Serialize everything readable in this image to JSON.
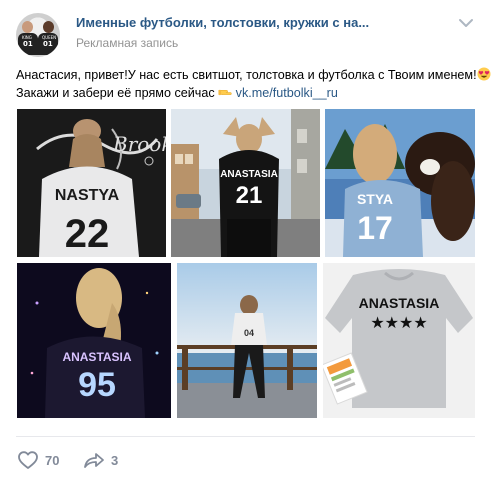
{
  "post": {
    "author": "Именные футболки, толстовки, кружки с на...",
    "subtitle": "Рекламная запись",
    "avatar_labels": {
      "left_small": "KING",
      "right_small": "QUEEN",
      "left_number": "01",
      "right_number": "01"
    },
    "text_line1": "Анастасия, привет!У нас есть свитшот, толстовка и футболка с Твоим именем!",
    "text_line2": "Закажи и забери её прямо сейчас",
    "link": "vk.me/futbolki__ru",
    "emojis": [
      "heart-eyes-emoji",
      "pointing-hand-emoji"
    ]
  },
  "photos": [
    {
      "name": "NASTYA",
      "number": "22",
      "extra": "Brooklyn"
    },
    {
      "name": "ANASTASIA",
      "number": "21"
    },
    {
      "name": "STYA",
      "number": "17"
    },
    {
      "name": "ANASTASIA",
      "number": "95"
    },
    {
      "name": "",
      "number": "04"
    },
    {
      "name": "ANASTASIA",
      "number": "★★★★"
    }
  ],
  "actions": {
    "likes": "70",
    "shares": "3"
  },
  "colors": {
    "link": "#2a5885",
    "muted": "#939393",
    "action_gray": "#828a99",
    "divider": "#e7e8ec"
  }
}
